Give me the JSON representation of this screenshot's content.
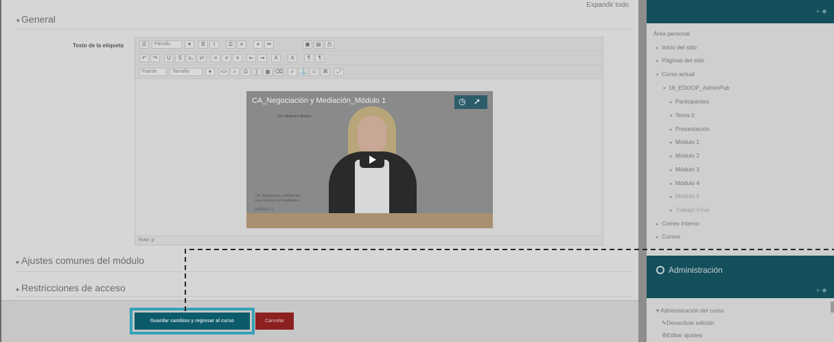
{
  "main": {
    "expand_all": "Expandir todo",
    "section_general": "General",
    "field_label": "Texto de la etiqueta",
    "section_common": "Ajustes comunes del módulo",
    "section_restrictions": "Restricciones de acceso",
    "save_button": "Guardar cambios y regresar al curso",
    "cancel_button": "Cancelar"
  },
  "editor": {
    "paragraph_select": "Párrafo",
    "font_select": "Fuente",
    "size_select": "Tamaño",
    "path": "Ruta: p"
  },
  "video": {
    "title": "CA_Negociación y Mediación_Módulo 1",
    "speaker": "Dra. Alejandra Álvarez",
    "side_text_1": "CA_Negociación y Mediación",
    "side_text_2": "para Centros de Estudiantes",
    "side_text_3": "MÓDULO 1"
  },
  "sidebar": {
    "nav_header_ctrl": "+ ❖",
    "nav_items": [
      {
        "label": "Área personal",
        "caret": ""
      },
      {
        "label": "Inicio del sitio",
        "caret": "▸"
      },
      {
        "label": "Páginas del sitio",
        "caret": "▸"
      },
      {
        "label": "Curso actual",
        "caret": "▾"
      },
      {
        "label": "18_EDOOP_AdminPub",
        "caret": "▾"
      },
      {
        "label": "Participantes",
        "caret": "▸"
      },
      {
        "label": "Tema 0",
        "caret": "▾"
      },
      {
        "label": "Presentación",
        "caret": "▸"
      },
      {
        "label": "Módulo 1",
        "caret": "▸"
      },
      {
        "label": "Módulo 2",
        "caret": "▸"
      },
      {
        "label": "Módulo 3",
        "caret": "▸"
      },
      {
        "label": "Módulo 4",
        "caret": "▸"
      },
      {
        "label": "Módulo 5",
        "caret": "▸"
      },
      {
        "label": "Trabajo Final",
        "caret": "▸"
      },
      {
        "label": "Correo Interno",
        "caret": "▸"
      },
      {
        "label": "Cursos",
        "caret": "▸"
      }
    ],
    "admin_title": "Administración",
    "admin_ctrl": "+ ❖",
    "admin_items": [
      {
        "label": "Administración del curso",
        "icon": "▾"
      },
      {
        "label": "Desactivar edición",
        "icon": "✎"
      },
      {
        "label": "Editar ajustes",
        "icon": "⚙"
      }
    ]
  },
  "colors": {
    "sidebar_header": "#154f5c",
    "save_button": "#0c5b6b",
    "cancel_button": "#8c1f1f",
    "highlight": "#35a2b8"
  }
}
